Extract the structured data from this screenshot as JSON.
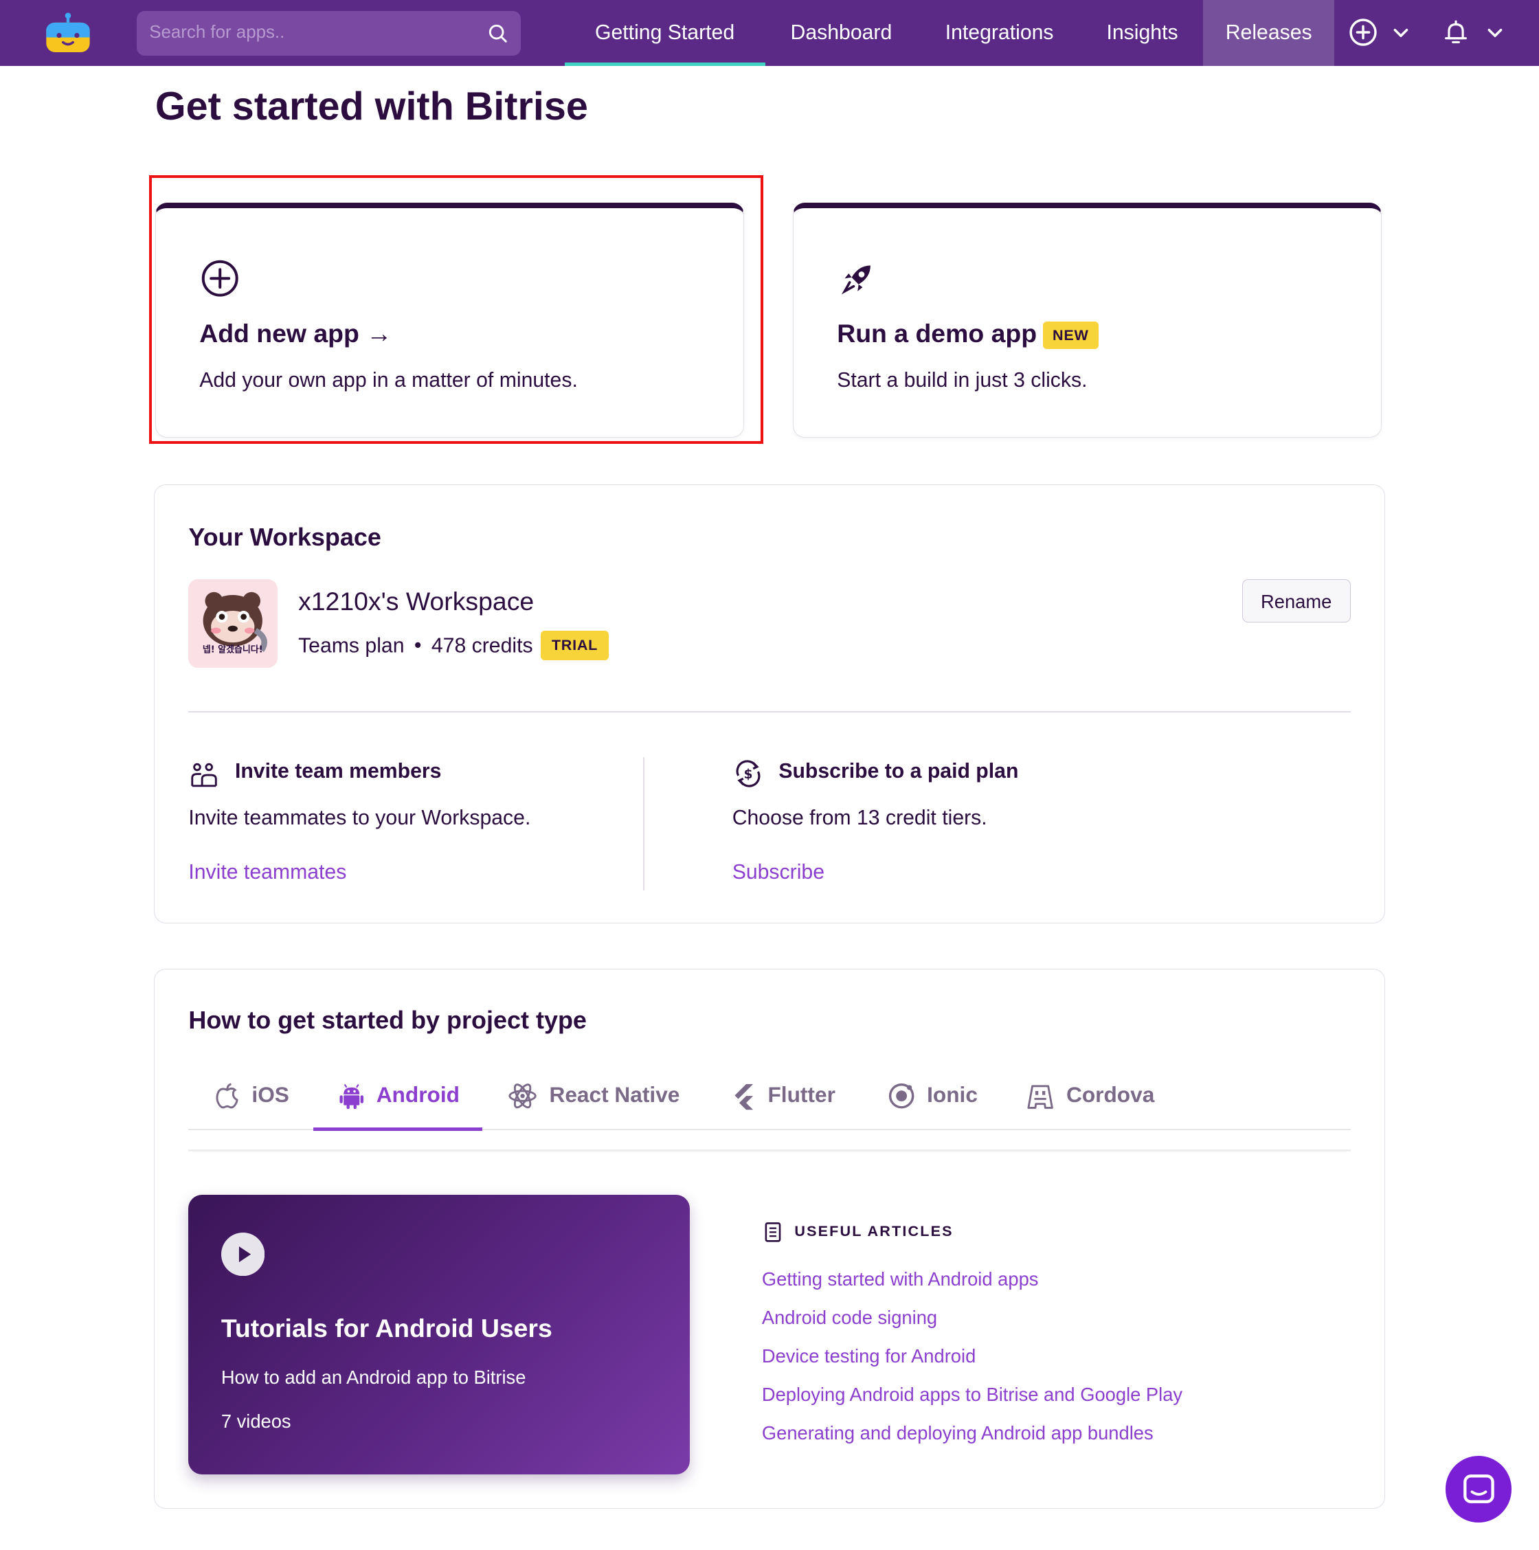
{
  "nav": {
    "search_placeholder": "Search for apps..",
    "tabs": [
      {
        "label": "Getting Started",
        "active": true
      },
      {
        "label": "Dashboard"
      },
      {
        "label": "Integrations"
      },
      {
        "label": "Insights"
      },
      {
        "label": "Releases",
        "highlighted": true
      }
    ],
    "icons": [
      "bitrise-logo-icon",
      "search-icon",
      "plus-circle-icon",
      "chevron-down-icon",
      "bell-icon",
      "chevron-down-icon"
    ],
    "colors": {
      "bar": "#5b2a86",
      "active_underline": "#3fd1c1"
    }
  },
  "page_title": "Get started with Bitrise",
  "cards": {
    "add_app": {
      "title": "Add new app →",
      "desc": "Add your own app in a matter of minutes.",
      "icon": "plus-circle-icon"
    },
    "demo_app": {
      "title": "Run a demo app",
      "badge": "NEW",
      "desc": "Start a build in just 3 clicks.",
      "icon": "rocket-icon"
    }
  },
  "workspace": {
    "section_title": "Your Workspace",
    "name": "x1210x's Workspace",
    "plan": "Teams plan",
    "credits": "478 credits",
    "badge": "TRIAL",
    "avatar_text": "넵! 알겠습니다!",
    "rename_label": "Rename",
    "invite": {
      "title": "Invite team members",
      "desc": "Invite teammates to your Workspace.",
      "link": "Invite teammates",
      "icon": "team-icon"
    },
    "subscribe": {
      "title": "Subscribe to a paid plan",
      "desc": "Choose from 13 credit tiers.",
      "link": "Subscribe",
      "icon": "dollar-cycle-icon"
    }
  },
  "project_types": {
    "section_title": "How to get started by project type",
    "tabs": [
      {
        "label": "iOS",
        "icon": "apple-icon"
      },
      {
        "label": "Android",
        "icon": "android-icon",
        "active": true
      },
      {
        "label": "React Native",
        "icon": "react-icon"
      },
      {
        "label": "Flutter",
        "icon": "flutter-icon"
      },
      {
        "label": "Ionic",
        "icon": "ionic-icon"
      },
      {
        "label": "Cordova",
        "icon": "cordova-icon"
      }
    ],
    "tutorial": {
      "title": "Tutorials for Android Users",
      "subtitle": "How to add an Android app to Bitrise",
      "count": "7 videos"
    },
    "articles_heading": "USEFUL ARTICLES",
    "articles": [
      "Getting started with Android apps",
      "Android code signing",
      "Device testing for Android",
      "Deploying Android apps to Bitrise and Google Play",
      "Generating and deploying Android app bundles"
    ]
  },
  "colors": {
    "brand_purple": "#5b2a86",
    "link_purple": "#8c3fcf",
    "badge_yellow": "#f7d53a",
    "highlight_red": "#ee1111"
  }
}
